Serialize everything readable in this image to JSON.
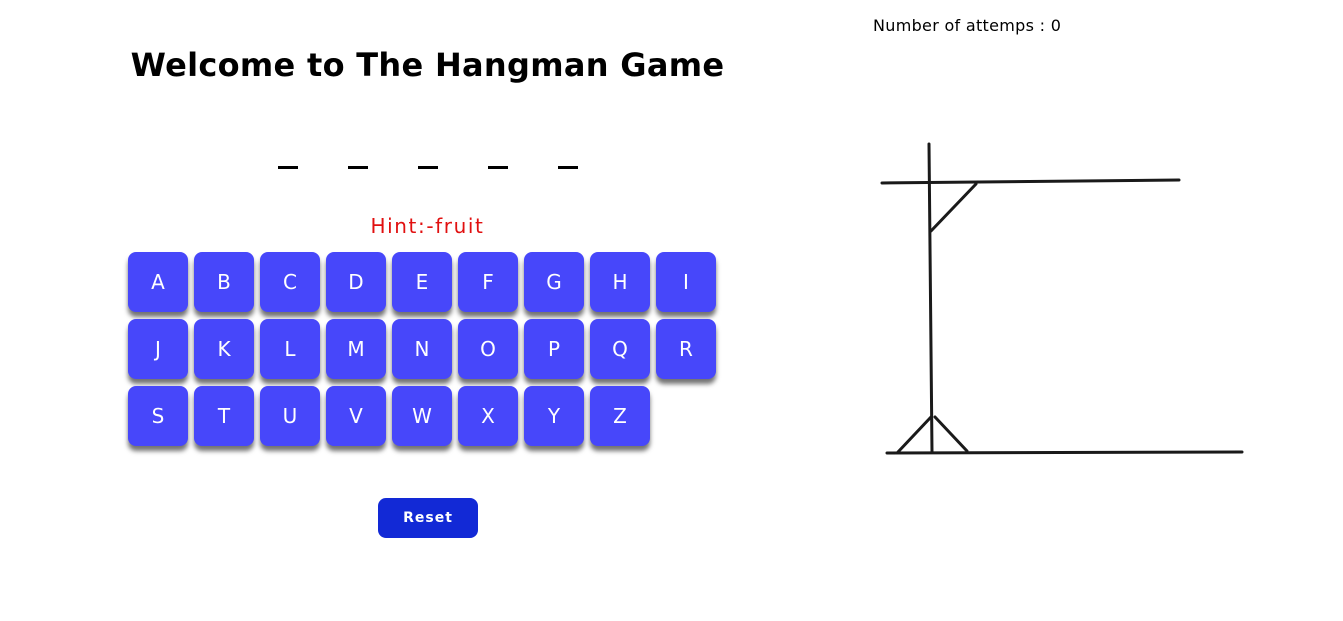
{
  "game": {
    "title": "Welcome to The Hangman Game",
    "hint": "Hint:-fruit",
    "word_blanks": [
      "_",
      "_",
      "_",
      "_",
      "_"
    ],
    "attempts_label": "Number of attemps : 0",
    "reset_label": "Reset"
  },
  "keyboard": {
    "letters": [
      "A",
      "B",
      "C",
      "D",
      "E",
      "F",
      "G",
      "H",
      "I",
      "J",
      "K",
      "L",
      "M",
      "N",
      "O",
      "P",
      "Q",
      "R",
      "S",
      "T",
      "U",
      "V",
      "W",
      "X",
      "Y",
      "Z"
    ]
  },
  "colors": {
    "key_background": "#4747fa",
    "reset_background": "#1229d6",
    "hint": "#e11010"
  }
}
